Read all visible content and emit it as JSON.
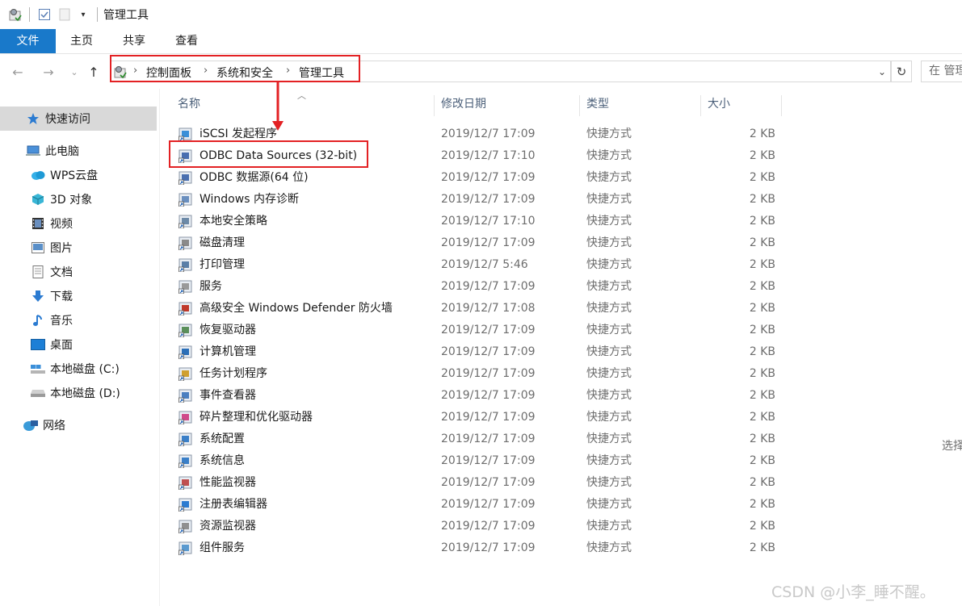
{
  "window": {
    "title": "管理工具"
  },
  "ribbon": {
    "tabs": {
      "file": "文件",
      "home": "主页",
      "share": "共享",
      "view": "查看"
    }
  },
  "address": {
    "breadcrumbs": [
      "控制面板",
      "系统和安全",
      "管理工具"
    ],
    "search_placeholder": "在 管理工具"
  },
  "sidebar": {
    "items": [
      {
        "label": "快速访问",
        "icon": "star-icon"
      },
      {
        "label": "此电脑",
        "icon": "pc-icon"
      },
      {
        "label": "WPS云盘",
        "icon": "cloud-icon"
      },
      {
        "label": "3D 对象",
        "icon": "cube-icon"
      },
      {
        "label": "视频",
        "icon": "video-icon"
      },
      {
        "label": "图片",
        "icon": "picture-icon"
      },
      {
        "label": "文档",
        "icon": "document-icon"
      },
      {
        "label": "下载",
        "icon": "download-icon"
      },
      {
        "label": "音乐",
        "icon": "music-icon"
      },
      {
        "label": "桌面",
        "icon": "desktop-icon"
      },
      {
        "label": "本地磁盘 (C:)",
        "icon": "drive-c-icon"
      },
      {
        "label": "本地磁盘 (D:)",
        "icon": "drive-d-icon"
      },
      {
        "label": "网络",
        "icon": "network-icon"
      }
    ]
  },
  "columns": {
    "name": "名称",
    "date": "修改日期",
    "type": "类型",
    "size": "大小"
  },
  "files": [
    {
      "name": "iSCSI 发起程序",
      "date": "2019/12/7 17:09",
      "type": "快捷方式",
      "size": "2 KB"
    },
    {
      "name": "ODBC Data Sources (32-bit)",
      "date": "2019/12/7 17:10",
      "type": "快捷方式",
      "size": "2 KB"
    },
    {
      "name": "ODBC 数据源(64 位)",
      "date": "2019/12/7 17:09",
      "type": "快捷方式",
      "size": "2 KB"
    },
    {
      "name": "Windows 内存诊断",
      "date": "2019/12/7 17:09",
      "type": "快捷方式",
      "size": "2 KB"
    },
    {
      "name": "本地安全策略",
      "date": "2019/12/7 17:10",
      "type": "快捷方式",
      "size": "2 KB"
    },
    {
      "name": "磁盘清理",
      "date": "2019/12/7 17:09",
      "type": "快捷方式",
      "size": "2 KB"
    },
    {
      "name": "打印管理",
      "date": "2019/12/7 5:46",
      "type": "快捷方式",
      "size": "2 KB"
    },
    {
      "name": "服务",
      "date": "2019/12/7 17:09",
      "type": "快捷方式",
      "size": "2 KB"
    },
    {
      "name": "高级安全 Windows Defender 防火墙",
      "date": "2019/12/7 17:08",
      "type": "快捷方式",
      "size": "2 KB"
    },
    {
      "name": "恢复驱动器",
      "date": "2019/12/7 17:09",
      "type": "快捷方式",
      "size": "2 KB"
    },
    {
      "name": "计算机管理",
      "date": "2019/12/7 17:09",
      "type": "快捷方式",
      "size": "2 KB"
    },
    {
      "name": "任务计划程序",
      "date": "2019/12/7 17:09",
      "type": "快捷方式",
      "size": "2 KB"
    },
    {
      "name": "事件查看器",
      "date": "2019/12/7 17:09",
      "type": "快捷方式",
      "size": "2 KB"
    },
    {
      "name": "碎片整理和优化驱动器",
      "date": "2019/12/7 17:09",
      "type": "快捷方式",
      "size": "2 KB"
    },
    {
      "name": "系统配置",
      "date": "2019/12/7 17:09",
      "type": "快捷方式",
      "size": "2 KB"
    },
    {
      "name": "系统信息",
      "date": "2019/12/7 17:09",
      "type": "快捷方式",
      "size": "2 KB"
    },
    {
      "name": "性能监视器",
      "date": "2019/12/7 17:09",
      "type": "快捷方式",
      "size": "2 KB"
    },
    {
      "name": "注册表编辑器",
      "date": "2019/12/7 17:09",
      "type": "快捷方式",
      "size": "2 KB"
    },
    {
      "name": "资源监视器",
      "date": "2019/12/7 17:09",
      "type": "快捷方式",
      "size": "2 KB"
    },
    {
      "name": "组件服务",
      "date": "2019/12/7 17:09",
      "type": "快捷方式",
      "size": "2 KB"
    }
  ],
  "preview_hint": "选择",
  "watermark": "CSDN @小李_睡不醒。",
  "colors": {
    "accent": "#1979ca",
    "annotation": "#e32124",
    "selection": "#d9d9d9"
  }
}
